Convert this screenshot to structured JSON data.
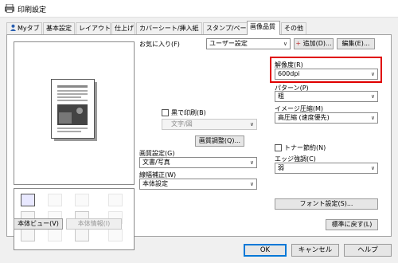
{
  "window": {
    "title": "印刷設定"
  },
  "tabs": [
    {
      "label": "Myタブ"
    },
    {
      "label": "基本設定"
    },
    {
      "label": "レイアウト"
    },
    {
      "label": "仕上げ"
    },
    {
      "label": "カバーシート/挿入紙"
    },
    {
      "label": "スタンプ/ページ印字"
    },
    {
      "label": "画像品質",
      "active": true
    },
    {
      "label": "その他"
    }
  ],
  "left": {
    "preview_button": "本体ビュー(V)",
    "device_info_button": "本体情報(I)"
  },
  "favorites": {
    "label": "お気に入り(F)",
    "value": "ユーザー設定",
    "add_button": "追加(D)...",
    "edit_button": "編集(E)..."
  },
  "grayscale": {
    "checkbox_label": "黒で印刷(B)",
    "checked": false,
    "select_value": "文字/図"
  },
  "quality_adjust_button": "画質調整(Q)...",
  "image_setting": {
    "label": "画質設定(G)",
    "value": "文書/写真"
  },
  "line_width": {
    "label": "線幅補正(W)",
    "value": "本体設定"
  },
  "resolution": {
    "label": "解像度(R)",
    "value": "600dpi",
    "highlight_color": "#e00000"
  },
  "pattern": {
    "label": "パターン(P)",
    "value": "粗"
  },
  "compression": {
    "label": "イメージ圧縮(M)",
    "value": "高圧縮 (速度優先)"
  },
  "toner_save": {
    "label": "トナー節約(N)",
    "checked": false
  },
  "edge_enhance": {
    "label": "エッジ強調(C)",
    "value": "弱"
  },
  "font_settings_button": "フォント設定(S)...",
  "restore_defaults_button": "標準に戻す(L)",
  "dialog_buttons": {
    "ok": "OK",
    "cancel": "キャンセル",
    "help": "ヘルプ"
  }
}
